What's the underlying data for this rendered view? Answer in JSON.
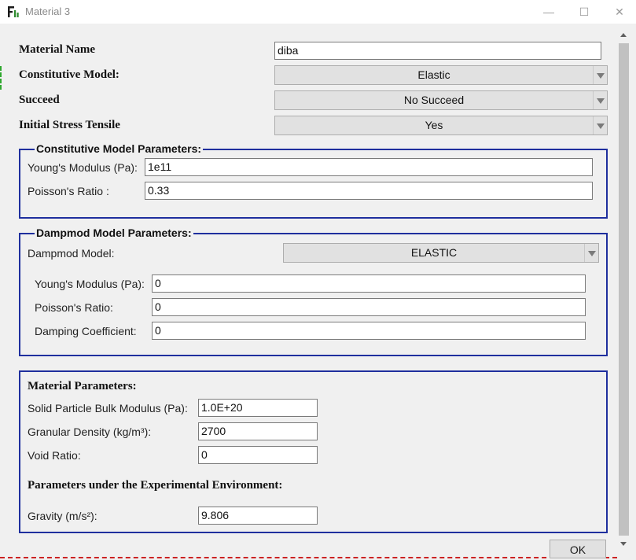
{
  "window": {
    "title": "Material 3",
    "minimize": "—",
    "maximize": "☐",
    "close": "✕"
  },
  "material_name": {
    "label": "Material Name",
    "value": "diba"
  },
  "constitutive_model": {
    "label": "Constitutive Model:",
    "value": "Elastic"
  },
  "succeed": {
    "label": "Succeed",
    "value": "No Succeed"
  },
  "initial_stress": {
    "label": "Initial Stress Tensile",
    "value": "Yes"
  },
  "cm_params": {
    "title": "Constitutive Model Parameters:",
    "youngs_label": "Young's Modulus (Pa):",
    "youngs_value": "1e11",
    "poisson_label": "Poisson's Ratio :",
    "poisson_value": "0.33"
  },
  "dampmod": {
    "title": "Dampmod Model Parameters:",
    "model_label": "Dampmod Model:",
    "model_value": "ELASTIC",
    "youngs_label": "Young's Modulus (Pa):",
    "youngs_value": "0",
    "poisson_label": "Poisson's Ratio:",
    "poisson_value": "0",
    "damping_label": "Damping Coefficient:",
    "damping_value": "0"
  },
  "material_params": {
    "title": "Material Parameters:",
    "bulk_label": "Solid Particle Bulk Modulus (Pa):",
    "bulk_value": "1.0E+20",
    "density_label": "Granular Density (kg/m³):",
    "density_value": "2700",
    "void_label": "Void Ratio:",
    "void_value": "0",
    "env_title": "Parameters under the Experimental Environment:",
    "gravity_label": "Gravity (m/s²):",
    "gravity_value": "9.806"
  },
  "ok_button": "OK",
  "colors": {
    "group_border": "#1f2f9e",
    "background": "#f0f0f0"
  }
}
